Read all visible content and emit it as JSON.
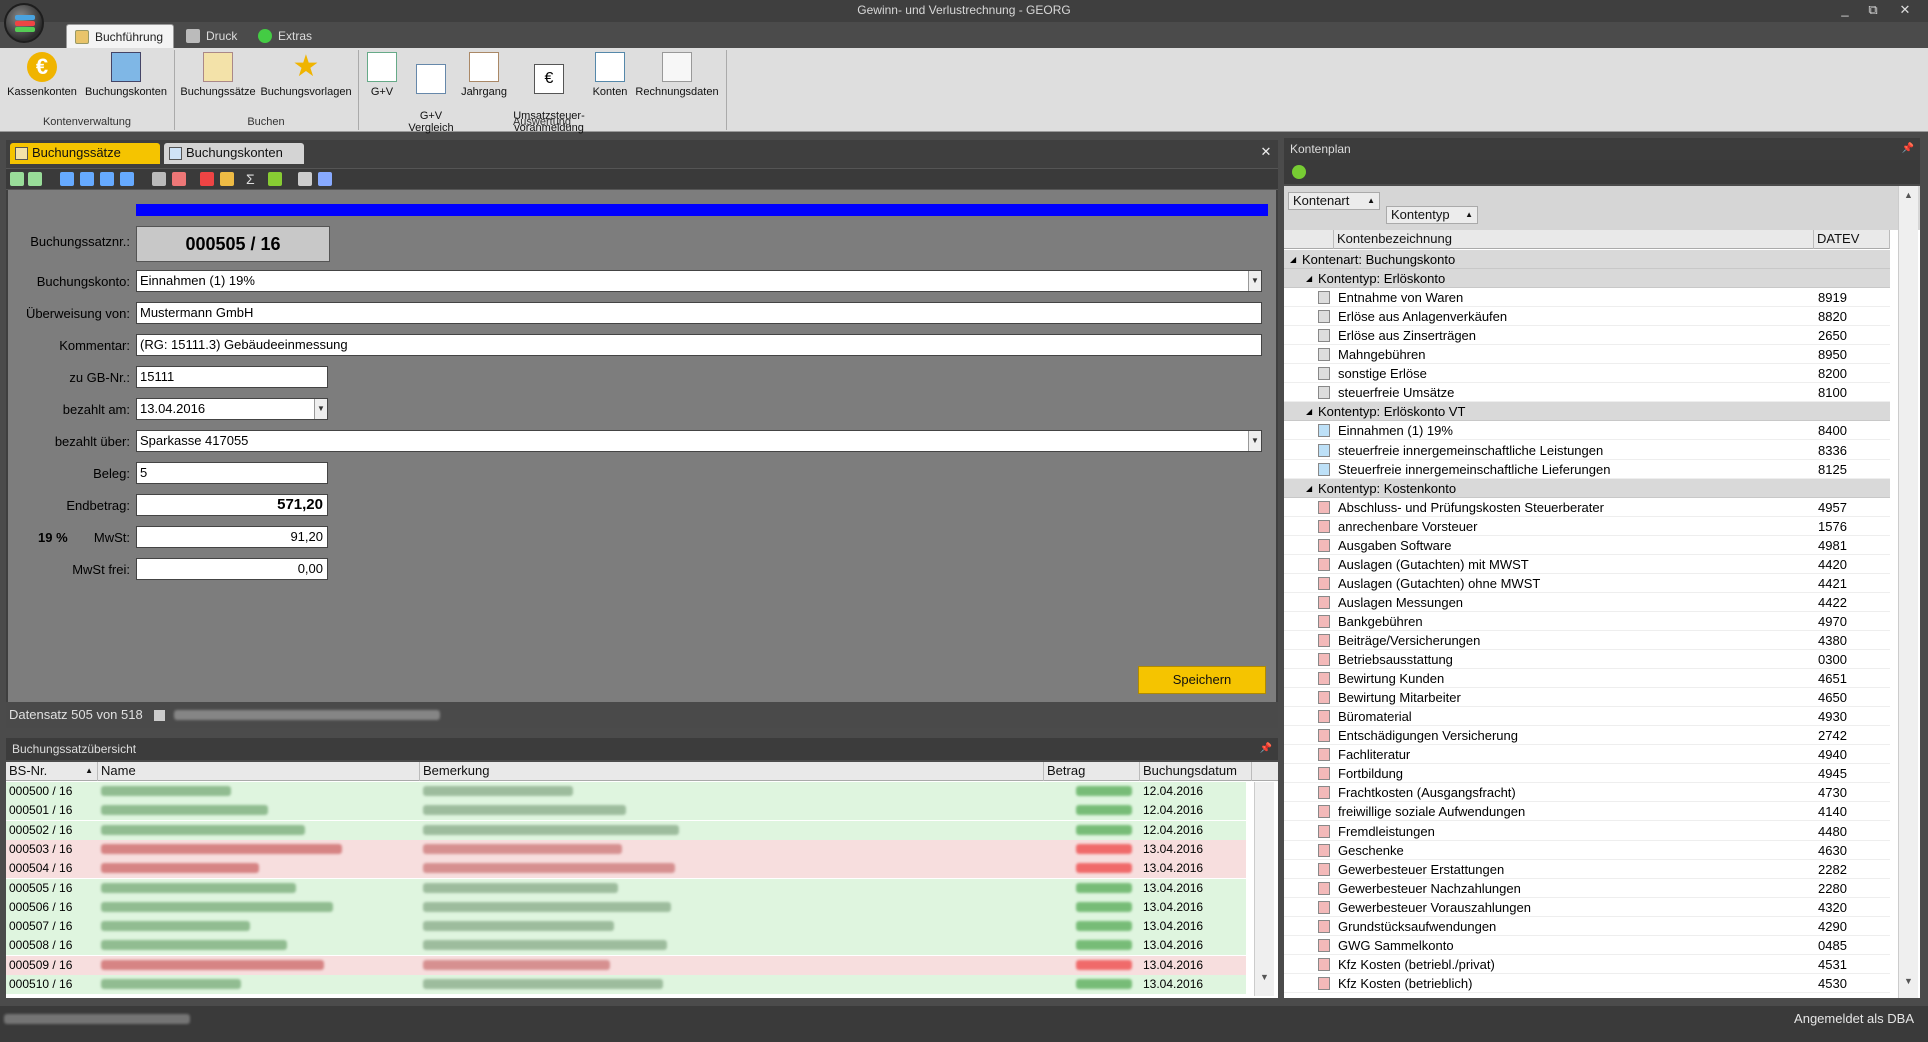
{
  "window": {
    "title": "Gewinn- und Verlustrechnung - GEORG",
    "min": "_",
    "restore": "⧉",
    "close": "✕"
  },
  "ribbon_tabs": [
    {
      "label": "Buchführung",
      "active": true
    },
    {
      "label": "Druck",
      "active": false
    },
    {
      "label": "Extras",
      "active": false
    }
  ],
  "ribbon_groups": [
    {
      "label": "Kontenverwaltung",
      "buttons": [
        "Kassenkonten",
        "Buchungskonten"
      ]
    },
    {
      "label": "Buchen",
      "buttons": [
        "Buchungssätze",
        "Buchungsvorlagen"
      ]
    },
    {
      "label": "Auswertung",
      "buttons": [
        "G+V",
        "G+V\nVergleich",
        "Jahrgang",
        "Umsatzsteuer-\nvoranmeldung",
        "Konten",
        "Rechnungsdaten"
      ]
    }
  ],
  "doc_tabs": [
    {
      "label": "Buchungssätze",
      "active": true
    },
    {
      "label": "Buchungskonten",
      "active": false
    }
  ],
  "doc_close": "✕",
  "form": {
    "buchungssatznr_label": "Buchungssatznr.:",
    "buchungssatznr": "000505 / 16",
    "buchungskonto_label": "Buchungskonto:",
    "buchungskonto": "Einnahmen (1) 19%",
    "ueberweisung_label": "Überweisung von:",
    "ueberweisung": "Mustermann GmbH",
    "kommentar_label": "Kommentar:",
    "kommentar": "(RG: 15111.3) Gebäudeeinmessung",
    "gbnr_label": "zu GB-Nr.:",
    "gbnr": "15111",
    "bezahlt_am_label": "bezahlt am:",
    "bezahlt_am": "13.04.2016",
    "bezahlt_ueber_label": "bezahlt über:",
    "bezahlt_ueber": "Sparkasse 417055",
    "beleg_label": "Beleg:",
    "beleg": "5",
    "endbetrag_label": "Endbetrag:",
    "endbetrag": "571,20",
    "mwst_rate": "19 %",
    "mwst_label": "MwSt:",
    "mwst": "91,20",
    "mwst_frei_label": "MwSt frei:",
    "mwst_frei": "0,00",
    "save_label": "Speichern",
    "progress_fraction": 1.0
  },
  "status": {
    "record": "Datensatz 505 von 518"
  },
  "overview": {
    "title": "Buchungssatzübersicht",
    "pin": "📌",
    "columns": [
      "BS-Nr.",
      "Name",
      "Bemerkung",
      "Betrag",
      "Buchungsdatum"
    ],
    "rows": [
      {
        "nr": "000500 / 16",
        "date": "12.04.2016",
        "type": "income"
      },
      {
        "nr": "000501 / 16",
        "date": "12.04.2016",
        "type": "income"
      },
      {
        "nr": "000502 / 16",
        "date": "12.04.2016",
        "type": "income"
      },
      {
        "nr": "000503 / 16",
        "date": "13.04.2016",
        "type": "expense"
      },
      {
        "nr": "000504 / 16",
        "date": "13.04.2016",
        "type": "expense"
      },
      {
        "nr": "000505 / 16",
        "date": "13.04.2016",
        "type": "income"
      },
      {
        "nr": "000506 / 16",
        "date": "13.04.2016",
        "type": "income"
      },
      {
        "nr": "000507 / 16",
        "date": "13.04.2016",
        "type": "income"
      },
      {
        "nr": "000508 / 16",
        "date": "13.04.2016",
        "type": "income"
      },
      {
        "nr": "000509 / 16",
        "date": "13.04.2016",
        "type": "expense"
      },
      {
        "nr": "000510 / 16",
        "date": "13.04.2016",
        "type": "income"
      }
    ]
  },
  "kontenplan": {
    "title": "Kontenplan",
    "pin": "📌",
    "group_chips": [
      "Kontenart",
      "Kontentyp"
    ],
    "columns": [
      "Kontenbezeichnung",
      "DATEV"
    ],
    "rows": [
      {
        "kind": "g1",
        "text": "Kontenart:  Buchungskonto"
      },
      {
        "kind": "g2",
        "text": "Kontentyp:  Erlöskonto"
      },
      {
        "kind": "item",
        "icon": "book",
        "name": "Entnahme von Waren",
        "datev": "8919"
      },
      {
        "kind": "item",
        "icon": "book",
        "name": "Erlöse aus Anlagenverkäufen",
        "datev": "8820"
      },
      {
        "kind": "item",
        "icon": "book",
        "name": "Erlöse aus Zinserträgen",
        "datev": "2650"
      },
      {
        "kind": "item",
        "icon": "book",
        "name": "Mahngebühren",
        "datev": "8950"
      },
      {
        "kind": "item",
        "icon": "book",
        "name": "sonstige Erlöse",
        "datev": "8200"
      },
      {
        "kind": "item",
        "icon": "book",
        "name": "steuerfreie Umsätze",
        "datev": "8100"
      },
      {
        "kind": "g2",
        "text": "Kontentyp:  Erlöskonto VT"
      },
      {
        "kind": "item",
        "icon": "doc-blue",
        "name": "Einnahmen (1) 19%",
        "datev": "8400"
      },
      {
        "kind": "item",
        "icon": "doc-blue",
        "name": "steuerfreie innergemeinschaftliche Leistungen",
        "datev": "8336"
      },
      {
        "kind": "item",
        "icon": "doc-blue",
        "name": "Steuerfreie innergemeinschaftliche Lieferungen",
        "datev": "8125"
      },
      {
        "kind": "g2",
        "text": "Kontentyp:  Kostenkonto"
      },
      {
        "kind": "item",
        "icon": "doc-red",
        "name": "Abschluss- und Prüfungskosten Steuerberater",
        "datev": "4957"
      },
      {
        "kind": "item",
        "icon": "doc-red",
        "name": "anrechenbare Vorsteuer",
        "datev": "1576"
      },
      {
        "kind": "item",
        "icon": "doc-red",
        "name": "Ausgaben Software",
        "datev": "4981"
      },
      {
        "kind": "item",
        "icon": "doc-red",
        "name": "Auslagen (Gutachten) mit MWST",
        "datev": "4420"
      },
      {
        "kind": "item",
        "icon": "doc-red",
        "name": "Auslagen (Gutachten) ohne MWST",
        "datev": "4421"
      },
      {
        "kind": "item",
        "icon": "doc-red",
        "name": "Auslagen Messungen",
        "datev": "4422"
      },
      {
        "kind": "item",
        "icon": "doc-red",
        "name": "Bankgebühren",
        "datev": "4970"
      },
      {
        "kind": "item",
        "icon": "doc-red",
        "name": "Beiträge/Versicherungen",
        "datev": "4380"
      },
      {
        "kind": "item",
        "icon": "doc-red",
        "name": "Betriebsausstattung",
        "datev": "0300"
      },
      {
        "kind": "item",
        "icon": "doc-red",
        "name": "Bewirtung Kunden",
        "datev": "4651"
      },
      {
        "kind": "item",
        "icon": "doc-red",
        "name": "Bewirtung Mitarbeiter",
        "datev": "4650"
      },
      {
        "kind": "item",
        "icon": "doc-red",
        "name": "Büromaterial",
        "datev": "4930"
      },
      {
        "kind": "item",
        "icon": "doc-red",
        "name": "Entschädigungen Versicherung",
        "datev": "2742"
      },
      {
        "kind": "item",
        "icon": "doc-red",
        "name": "Fachliteratur",
        "datev": "4940"
      },
      {
        "kind": "item",
        "icon": "doc-red",
        "name": "Fortbildung",
        "datev": "4945"
      },
      {
        "kind": "item",
        "icon": "doc-red",
        "name": "Frachtkosten (Ausgangsfracht)",
        "datev": "4730"
      },
      {
        "kind": "item",
        "icon": "doc-red",
        "name": "freiwillige soziale Aufwendungen",
        "datev": "4140"
      },
      {
        "kind": "item",
        "icon": "doc-red",
        "name": "Fremdleistungen",
        "datev": "4480"
      },
      {
        "kind": "item",
        "icon": "doc-red",
        "name": "Geschenke",
        "datev": "4630"
      },
      {
        "kind": "item",
        "icon": "doc-red",
        "name": "Gewerbesteuer Erstattungen",
        "datev": "2282"
      },
      {
        "kind": "item",
        "icon": "doc-red",
        "name": "Gewerbesteuer Nachzahlungen",
        "datev": "2280"
      },
      {
        "kind": "item",
        "icon": "doc-red",
        "name": "Gewerbesteuer Vorauszahlungen",
        "datev": "4320"
      },
      {
        "kind": "item",
        "icon": "doc-red",
        "name": "Grundstücksaufwendungen",
        "datev": "4290"
      },
      {
        "kind": "item",
        "icon": "doc-red",
        "name": "GWG Sammelkonto",
        "datev": "0485"
      },
      {
        "kind": "item",
        "icon": "doc-red",
        "name": "Kfz Kosten (betriebl./privat)",
        "datev": "4531"
      },
      {
        "kind": "item",
        "icon": "doc-red",
        "name": "Kfz Kosten (betrieblich)",
        "datev": "4530"
      }
    ]
  },
  "footer": {
    "login": "Angemeldet als DBA"
  },
  "colors": {
    "accent": "#f5c400",
    "progress": "#0000ff",
    "income_row": "#dff5df",
    "expense_row": "#f7dede",
    "form_bg": "#7d7d7d"
  }
}
